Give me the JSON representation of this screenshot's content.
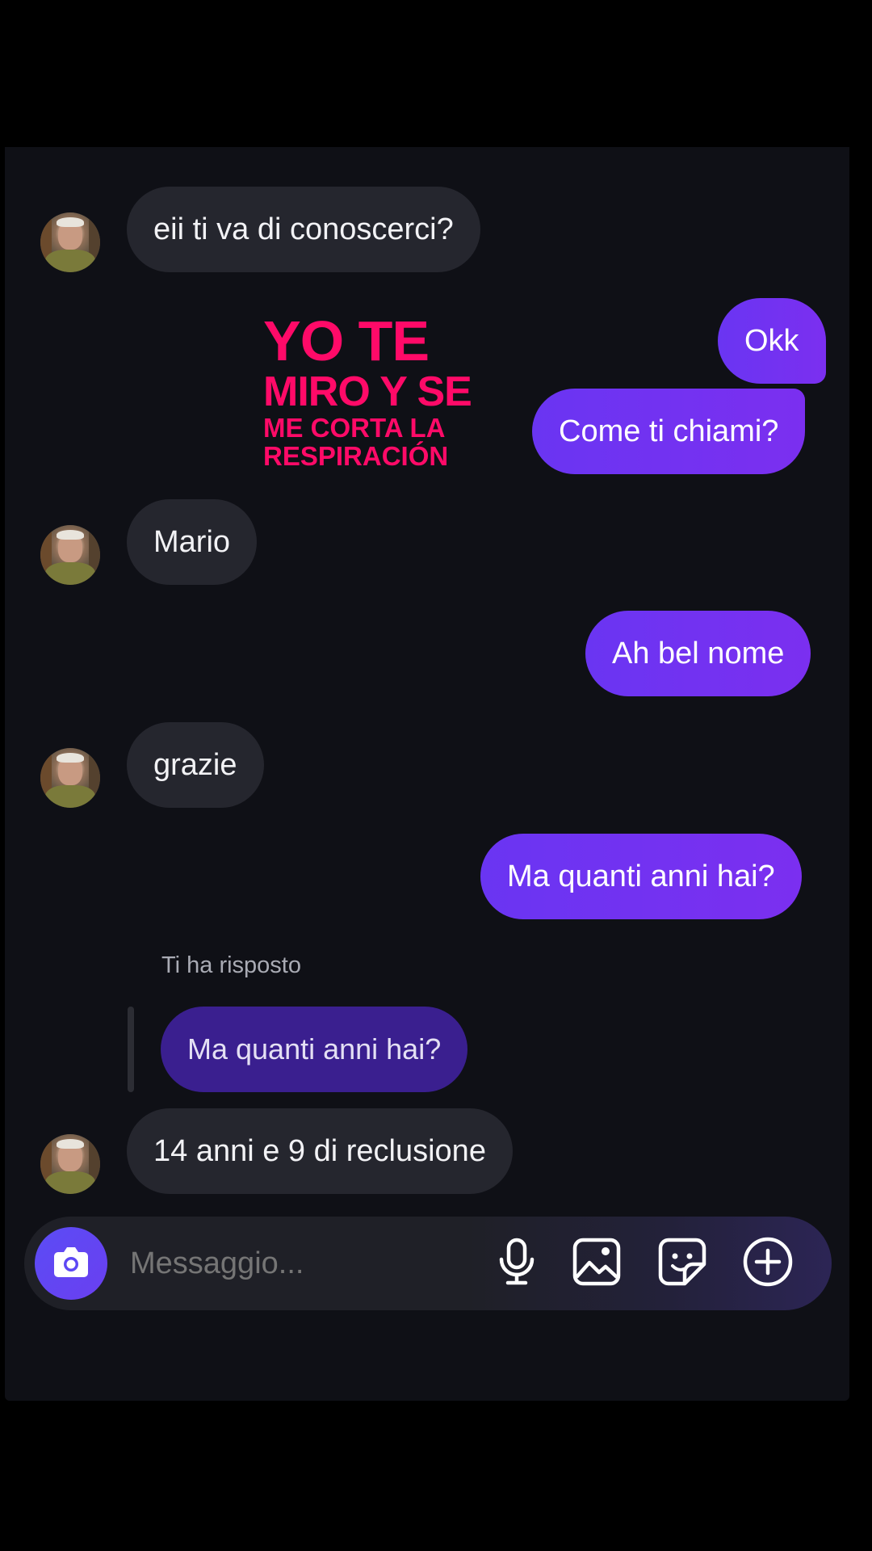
{
  "messages": [
    {
      "id": "m1",
      "direction": "incoming",
      "text": "eii ti va di conoscerci?"
    },
    {
      "id": "m2",
      "direction": "outgoing",
      "text": "Okk"
    },
    {
      "id": "m3",
      "direction": "outgoing",
      "text": "Come ti chiami?"
    },
    {
      "id": "m4",
      "direction": "incoming",
      "text": "Mario"
    },
    {
      "id": "m5",
      "direction": "outgoing",
      "text": "Ah bel nome"
    },
    {
      "id": "m6",
      "direction": "incoming",
      "text": "grazie"
    },
    {
      "id": "m7",
      "direction": "outgoing",
      "text": "Ma quanti anni hai?"
    },
    {
      "id": "m8",
      "direction": "incoming",
      "text": "14 anni e 9 di reclusione",
      "reply": {
        "label": "Ti ha risposto",
        "quoted_text": "Ma quanti anni hai?"
      }
    }
  ],
  "sticker": {
    "line1": "YO TE",
    "line2": "MIRO Y SE",
    "line3": "ME CORTA LA",
    "line4": "RESPIRACIÓN",
    "color": "#ff0a68"
  },
  "composer": {
    "placeholder": "Messaggio...",
    "buttons": [
      "camera-icon",
      "microphone-icon",
      "image-icon",
      "sticker-icon",
      "plus-circle-icon"
    ]
  },
  "colors": {
    "background": "#0f1016",
    "incoming_bubble": "#25262e",
    "outgoing_bubble": "#6a35f2",
    "quoted_bubble": "#3a1f8f"
  }
}
